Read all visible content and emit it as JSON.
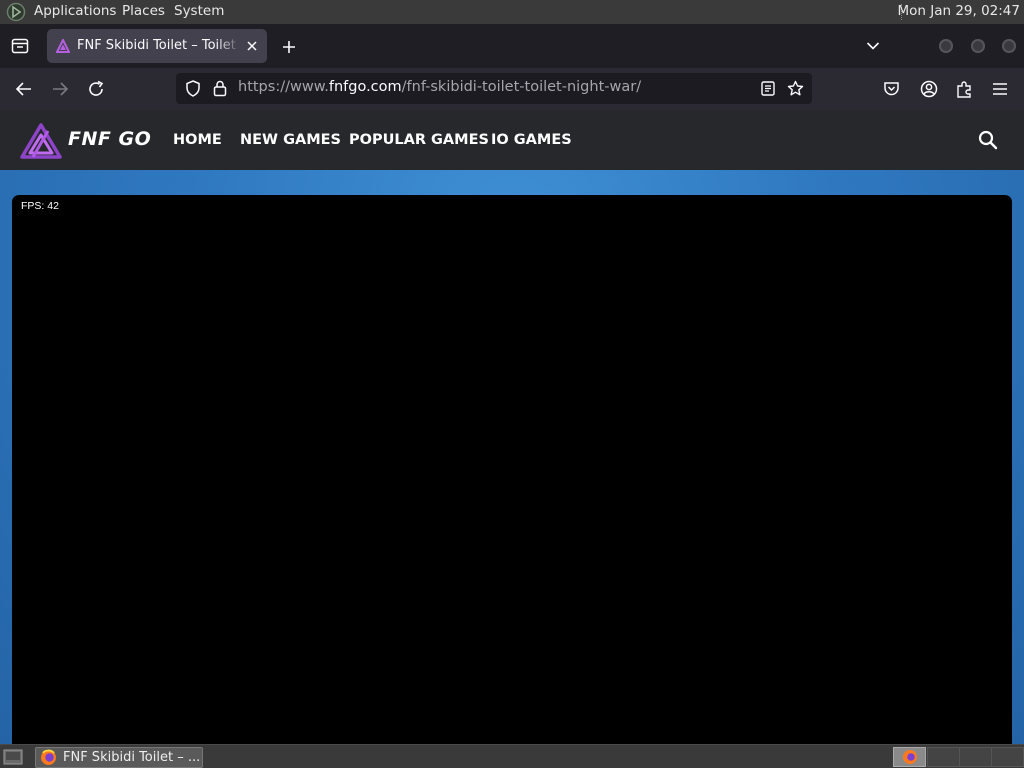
{
  "top_panel": {
    "menus": [
      "Applications",
      "Places",
      "System"
    ],
    "clock": "Mon Jan 29, 02:47"
  },
  "browser": {
    "tab": {
      "title": "FNF Skibidi Toilet – Toilet Night War"
    },
    "url": {
      "prefix": "https://www.",
      "host": "fnfgo.com",
      "path": "/fnf-skibidi-toilet-toilet-night-war/"
    }
  },
  "site": {
    "logo_text": "FNF GO",
    "nav": [
      "HOME",
      "NEW GAMES",
      "POPULAR GAMES",
      "IO GAMES"
    ]
  },
  "game": {
    "fps_text": "FPS: 42"
  },
  "taskbar": {
    "window_title": "FNF Skibidi Toilet – ..."
  },
  "colors": {
    "site_accent": "#9b4dca",
    "page_blue": "#2f78c0",
    "header_bg": "#27282c"
  }
}
